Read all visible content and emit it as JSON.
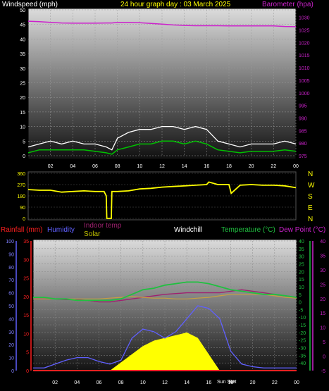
{
  "header": {
    "windspeed_label": "Windspeed (mph)",
    "title": "24 hour graph day : 03 March 2025",
    "barometer_label": "Barometer (hpa)"
  },
  "legend": {
    "rainfall": "Rainfall (mm)",
    "humidity": "Humidity",
    "indoor_temp": "Indoor temp",
    "solar": "Solar",
    "windchill": "Windchill",
    "temperature": "Temperature (°C)",
    "dew_point": "Dew Point (°C)"
  },
  "sun_labels": {
    "rise": "Sun Set",
    "set": "Set"
  },
  "colors": {
    "windspeed": "#ffffff",
    "wind_avg": "#00c000",
    "barometer": "#cc22cc",
    "direction": "#ffff00",
    "rainfall": "#ff2020",
    "humidity": "#6060ff",
    "indoor_temp": "#a02070",
    "solar": "#ffff00",
    "temperature": "#20c040",
    "dew_point": "#cc22cc",
    "windchill": "#ffffff"
  },
  "chart_data": [
    {
      "type": "line",
      "name": "wind-baro",
      "x_ticks": [
        "02",
        "04",
        "06",
        "08",
        "10",
        "12",
        "14",
        "16",
        "18",
        "20",
        "22",
        "00"
      ],
      "y_left_ticks": [
        "0",
        "5",
        "10",
        "15",
        "20",
        "25",
        "30",
        "35",
        "40",
        "45",
        "50"
      ],
      "y_right_ticks": [
        "975",
        "980",
        "985",
        "990",
        "995",
        "1000",
        "1005",
        "1010",
        "1015",
        "1020",
        "1025",
        "1030"
      ],
      "ylim_left": [
        0,
        50
      ],
      "ylim_right": [
        975,
        1033
      ],
      "hours": [
        0,
        1,
        2,
        3,
        4,
        5,
        6,
        7,
        7.5,
        8,
        9,
        10,
        11,
        12,
        13,
        14,
        15,
        16,
        17,
        18,
        19,
        20,
        21,
        22,
        23,
        24
      ],
      "gust": [
        3,
        4,
        5,
        4,
        5,
        4,
        4,
        3,
        2,
        6,
        8,
        9,
        9,
        10,
        10,
        9,
        10,
        9,
        5,
        4,
        3,
        4,
        4,
        4,
        5,
        4
      ],
      "average": [
        1,
        2,
        2,
        2,
        2,
        2,
        1.5,
        1,
        0.5,
        2,
        3,
        4,
        4,
        5,
        5,
        4,
        5,
        4,
        2,
        1.5,
        1,
        1.5,
        1.5,
        1.5,
        2,
        1.5
      ],
      "barometer": [
        1028.5,
        1028.3,
        1028.0,
        1027.8,
        1027.7,
        1027.7,
        1027.7,
        1027.8,
        1027.8,
        1028.0,
        1028.0,
        1027.9,
        1027.6,
        1027.3,
        1027.0,
        1026.8,
        1026.7,
        1026.7,
        1026.7,
        1026.6,
        1026.6,
        1026.6,
        1026.6,
        1026.6,
        1026.4,
        1026.3
      ]
    },
    {
      "type": "line",
      "name": "wind-direction",
      "y_ticks": [
        "360",
        "270",
        "180",
        "90",
        "0"
      ],
      "compass": [
        "N",
        "W",
        "S",
        "E",
        "N"
      ],
      "ylim": [
        0,
        360
      ],
      "hours": [
        0,
        1,
        2,
        3,
        4,
        5,
        6,
        6.8,
        7,
        7.05,
        7.45,
        7.5,
        8,
        9,
        10,
        11,
        12,
        13,
        14,
        15,
        16,
        16.2,
        17,
        18,
        18.2,
        19,
        20,
        21,
        22,
        23,
        24
      ],
      "direction": [
        230,
        225,
        225,
        210,
        215,
        220,
        215,
        215,
        180,
        0,
        0,
        215,
        215,
        220,
        235,
        240,
        250,
        255,
        260,
        265,
        270,
        290,
        270,
        270,
        200,
        265,
        270,
        265,
        265,
        260,
        245
      ]
    },
    {
      "type": "line",
      "name": "temp-humidity-solar",
      "x_ticks": [
        "02",
        "04",
        "06",
        "08",
        "10",
        "12",
        "14",
        "16",
        "18",
        "20",
        "22",
        "00"
      ],
      "y_humidity_ticks": [
        "0",
        "10",
        "20",
        "30",
        "40",
        "50",
        "60",
        "70",
        "80",
        "90",
        "100"
      ],
      "y_rain_ticks": [
        "0",
        "5",
        "10",
        "15",
        "20",
        "25",
        "30",
        "35"
      ],
      "y_temp_ticks": [
        "-40",
        "-35",
        "-30",
        "-25",
        "-20",
        "-15",
        "-10",
        "-5",
        "0",
        "5",
        "10",
        "15",
        "20",
        "25",
        "30",
        "35",
        "40"
      ],
      "y_dew_ticks": [
        "-5",
        "0",
        "5",
        "10",
        "15",
        "20",
        "25",
        "30",
        "35",
        "40"
      ],
      "ylim_temp": [
        -45,
        40
      ],
      "hours": [
        0,
        1,
        2,
        3,
        4,
        5,
        6,
        7,
        8,
        9,
        10,
        11,
        12,
        13,
        14,
        15,
        16,
        17,
        18,
        19,
        20,
        21,
        22,
        23,
        24
      ],
      "temperature": [
        3,
        3,
        2,
        2,
        1,
        1,
        1,
        1,
        2,
        5,
        8,
        9,
        11,
        12,
        13,
        13,
        12,
        10,
        8,
        7,
        6,
        5,
        5,
        4,
        3
      ],
      "indoor_temp": [
        2,
        2,
        2,
        1.5,
        1.5,
        1,
        0,
        0,
        1,
        2,
        3,
        4,
        5,
        5.5,
        6,
        6,
        6,
        6,
        7,
        8,
        7,
        6,
        5,
        4,
        3
      ],
      "dew_point": [
        2,
        2,
        2,
        2,
        2,
        2,
        2,
        2.5,
        3,
        3.5,
        3,
        2.5,
        2.5,
        2,
        2,
        2.5,
        3,
        4,
        5,
        5,
        5,
        5,
        4,
        3,
        2.5
      ],
      "humidity": [
        2,
        2,
        5,
        8,
        10,
        10,
        7,
        5,
        8,
        25,
        32,
        30,
        25,
        30,
        40,
        50,
        48,
        40,
        15,
        5,
        3,
        2,
        2,
        2,
        2
      ],
      "solar": [
        0,
        0,
        0,
        0,
        0,
        0,
        0,
        0,
        3,
        6,
        9,
        11,
        12,
        13,
        14,
        12,
        6,
        0,
        0,
        0,
        0,
        0,
        0,
        0,
        0
      ],
      "rainfall": [
        0,
        0,
        0,
        0,
        0,
        0,
        0,
        0,
        0,
        0,
        0,
        0,
        0,
        0,
        0,
        0,
        0,
        0,
        0,
        0,
        0,
        0,
        0,
        0,
        0
      ]
    }
  ]
}
